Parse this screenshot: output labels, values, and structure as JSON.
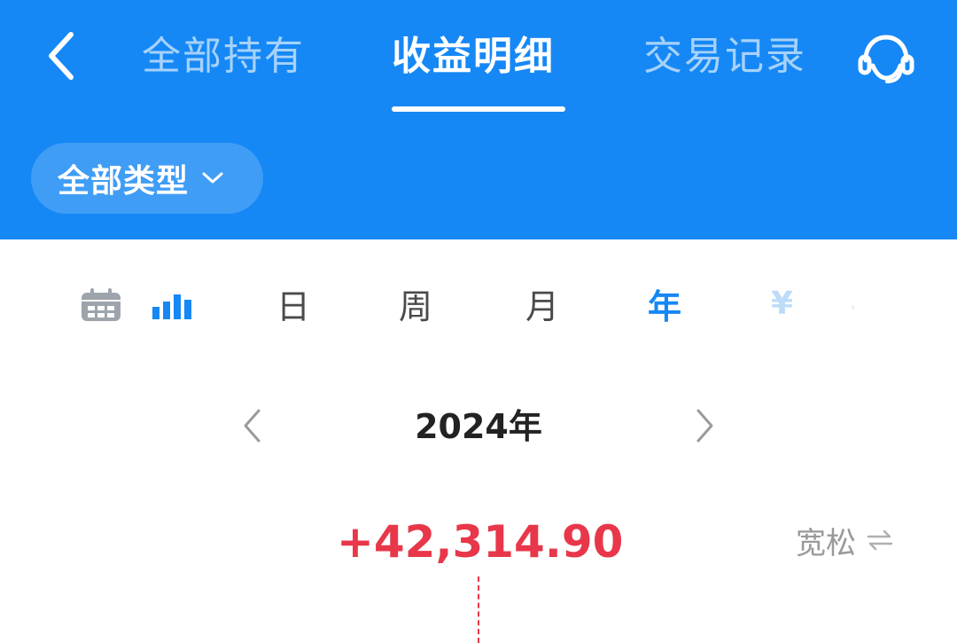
{
  "header": {
    "back_icon": "chevron-left-icon",
    "tabs": [
      {
        "label": "全部持有",
        "active": false
      },
      {
        "label": "收益明细",
        "active": true
      },
      {
        "label": "交易记录",
        "active": false
      }
    ],
    "service_icon": "customer-service-icon",
    "type_filter": {
      "label": "全部类型",
      "icon": "chevron-down-icon"
    }
  },
  "period": {
    "view_icons": [
      "calendar-icon",
      "bar-chart-icon"
    ],
    "tabs": [
      {
        "label": "日",
        "active": false
      },
      {
        "label": "周",
        "active": false
      },
      {
        "label": "月",
        "active": false
      },
      {
        "label": "年",
        "active": true
      },
      {
        "label": "¥",
        "active": false
      }
    ]
  },
  "year_nav": {
    "label": "2024年",
    "prev_icon": "chevron-left-icon",
    "next_icon": "chevron-right-icon"
  },
  "summary": {
    "profit": "+42,314.90",
    "mode_label": "宽松",
    "mode_icon": "swap-icon"
  },
  "colors": {
    "brand_blue": "#1688f5",
    "profit_red": "#e8374a"
  }
}
